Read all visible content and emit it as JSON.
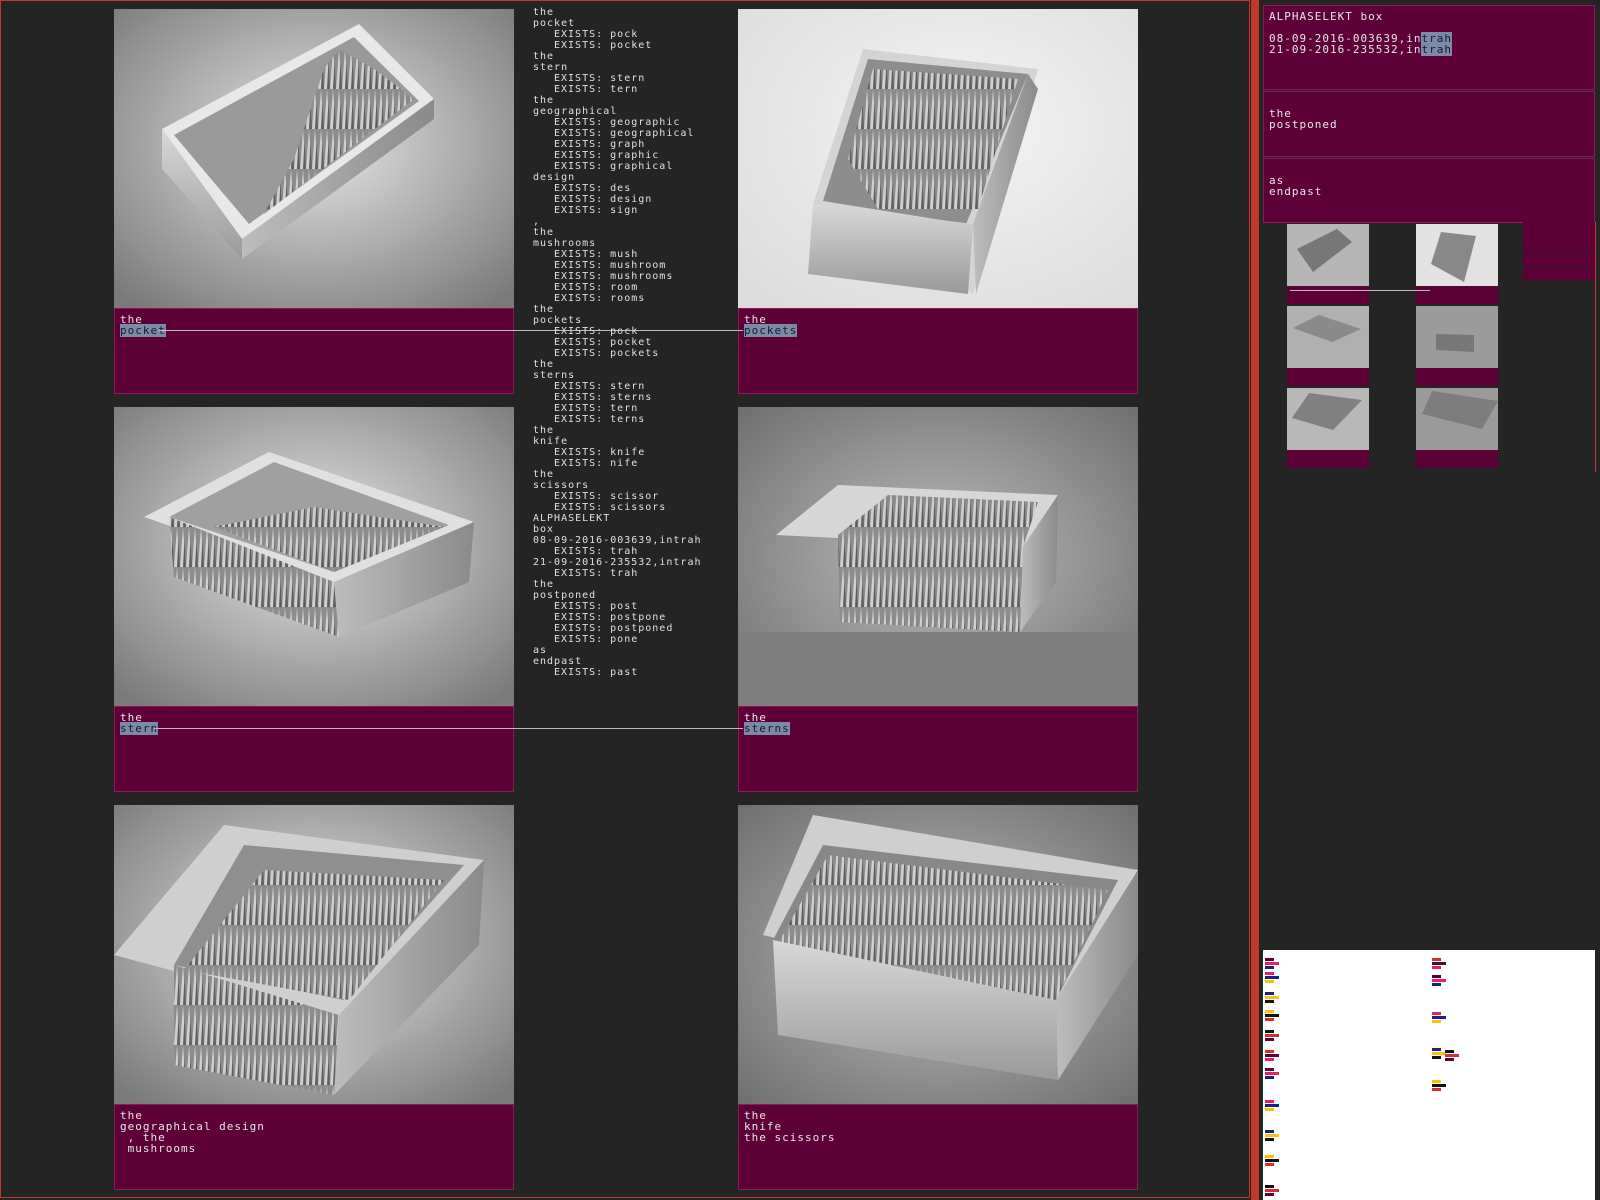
{
  "cards": [
    {
      "line1": "the",
      "line2": "pocket",
      "extra": ""
    },
    {
      "line1": "the",
      "line2": "pockets",
      "extra": ""
    },
    {
      "line1": "the",
      "line2": "stern",
      "extra": ""
    },
    {
      "line1": "the",
      "line2": "sterns",
      "extra": ""
    },
    {
      "line1": "the",
      "line2": "geographical design",
      "extra": "\n , the\n mushrooms"
    },
    {
      "line1": "the",
      "line2": "knife",
      "extra": "\nthe scissors"
    }
  ],
  "list": [
    {
      "t": "the",
      "i": false
    },
    {
      "t": "pocket",
      "i": false
    },
    {
      "t": "EXISTS: pock",
      "i": true
    },
    {
      "t": "EXISTS: pocket",
      "i": true
    },
    {
      "t": "the",
      "i": false
    },
    {
      "t": "stern",
      "i": false
    },
    {
      "t": "EXISTS: stern",
      "i": true
    },
    {
      "t": "EXISTS: tern",
      "i": true
    },
    {
      "t": "the",
      "i": false
    },
    {
      "t": "geographical",
      "i": false
    },
    {
      "t": "EXISTS: geographic",
      "i": true
    },
    {
      "t": "EXISTS: geographical",
      "i": true
    },
    {
      "t": "EXISTS: graph",
      "i": true
    },
    {
      "t": "EXISTS: graphic",
      "i": true
    },
    {
      "t": "EXISTS: graphical",
      "i": true
    },
    {
      "t": "design",
      "i": false
    },
    {
      "t": "EXISTS: des",
      "i": true
    },
    {
      "t": "EXISTS: design",
      "i": true
    },
    {
      "t": "EXISTS: sign",
      "i": true
    },
    {
      "t": ",",
      "i": false
    },
    {
      "t": "the",
      "i": false
    },
    {
      "t": "mushrooms",
      "i": false
    },
    {
      "t": "EXISTS: mush",
      "i": true
    },
    {
      "t": "EXISTS: mushroom",
      "i": true
    },
    {
      "t": "EXISTS: mushrooms",
      "i": true
    },
    {
      "t": "EXISTS: room",
      "i": true
    },
    {
      "t": "EXISTS: rooms",
      "i": true
    },
    {
      "t": "the",
      "i": false
    },
    {
      "t": "pockets",
      "i": false
    },
    {
      "t": "EXISTS: pock",
      "i": true
    },
    {
      "t": "EXISTS: pocket",
      "i": true
    },
    {
      "t": "EXISTS: pockets",
      "i": true
    },
    {
      "t": "the",
      "i": false
    },
    {
      "t": "sterns",
      "i": false
    },
    {
      "t": "EXISTS: stern",
      "i": true
    },
    {
      "t": "EXISTS: sterns",
      "i": true
    },
    {
      "t": "EXISTS: tern",
      "i": true
    },
    {
      "t": "EXISTS: terns",
      "i": true
    },
    {
      "t": "the",
      "i": false
    },
    {
      "t": "knife",
      "i": false
    },
    {
      "t": "EXISTS: knife",
      "i": true
    },
    {
      "t": "EXISTS: nife",
      "i": true
    },
    {
      "t": "the",
      "i": false
    },
    {
      "t": "scissors",
      "i": false
    },
    {
      "t": "EXISTS: scissor",
      "i": true
    },
    {
      "t": "EXISTS: scissors",
      "i": true
    },
    {
      "t": "ALPHASELEKT",
      "i": false
    },
    {
      "t": "box",
      "i": false
    },
    {
      "t": "08-09-2016-003639,intrah",
      "i": false
    },
    {
      "t": "EXISTS: trah",
      "i": true
    },
    {
      "t": "21-09-2016-235532,intrah",
      "i": false
    },
    {
      "t": "EXISTS: trah",
      "i": true
    },
    {
      "t": "the",
      "i": false
    },
    {
      "t": "postponed",
      "i": false
    },
    {
      "t": "EXISTS: post",
      "i": true
    },
    {
      "t": "EXISTS: postpone",
      "i": true
    },
    {
      "t": "EXISTS: postponed",
      "i": true
    },
    {
      "t": "EXISTS: pone",
      "i": true
    },
    {
      "t": "as",
      "i": false
    },
    {
      "t": "endpast",
      "i": false
    },
    {
      "t": "EXISTS: past",
      "i": true
    }
  ],
  "right": {
    "box_title": "ALPHASELEKT box",
    "entry1": "08-09-2016-003639,in",
    "entry1_hl": "trah",
    "entry2": "21-09-2016-235532,in",
    "entry2_hl": "trah",
    "post_1": "the",
    "post_2": "postponed",
    "end_1": "as",
    "end_2": "endpast"
  },
  "colors": {
    "caption": "#5e0038",
    "accent": "#c0392b",
    "highlight": "#7a8aa8"
  }
}
